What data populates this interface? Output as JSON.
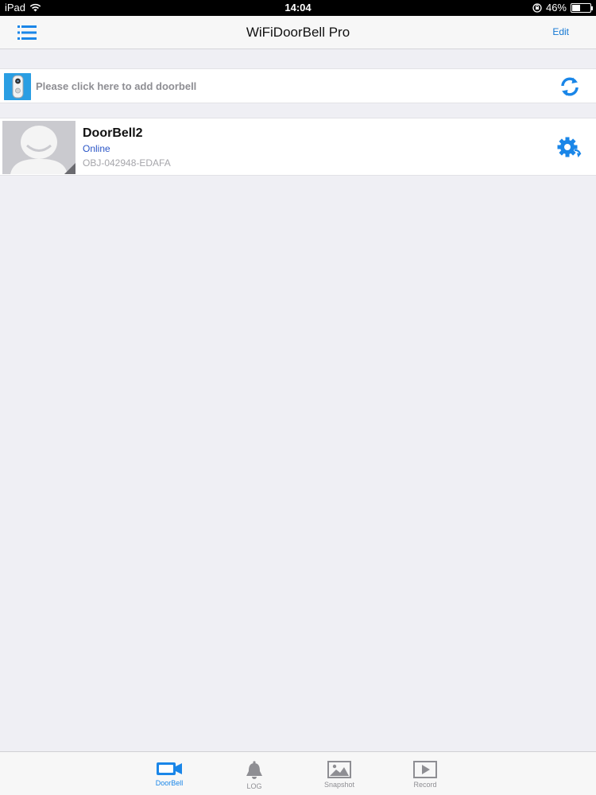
{
  "status_bar": {
    "device": "iPad",
    "time": "14:04",
    "battery_percent": "46%",
    "battery_level": 0.46
  },
  "nav": {
    "title": "WiFiDoorBell Pro",
    "edit_label": "Edit"
  },
  "add_row": {
    "label": "Please click here to add doorbell"
  },
  "devices": [
    {
      "name": "DoorBell2",
      "status": "Online",
      "id": "OBJ-042948-EDAFA"
    }
  ],
  "tabs": [
    {
      "label": "DoorBell",
      "icon": "camera-icon",
      "active": true
    },
    {
      "label": "LOG",
      "icon": "bell-icon",
      "active": false
    },
    {
      "label": "Snapshot",
      "icon": "image-icon",
      "active": false
    },
    {
      "label": "Record",
      "icon": "play-icon",
      "active": false
    }
  ],
  "colors": {
    "accent": "#1a86e8",
    "status_online": "#2b56c7",
    "inactive": "#8e8e93"
  }
}
